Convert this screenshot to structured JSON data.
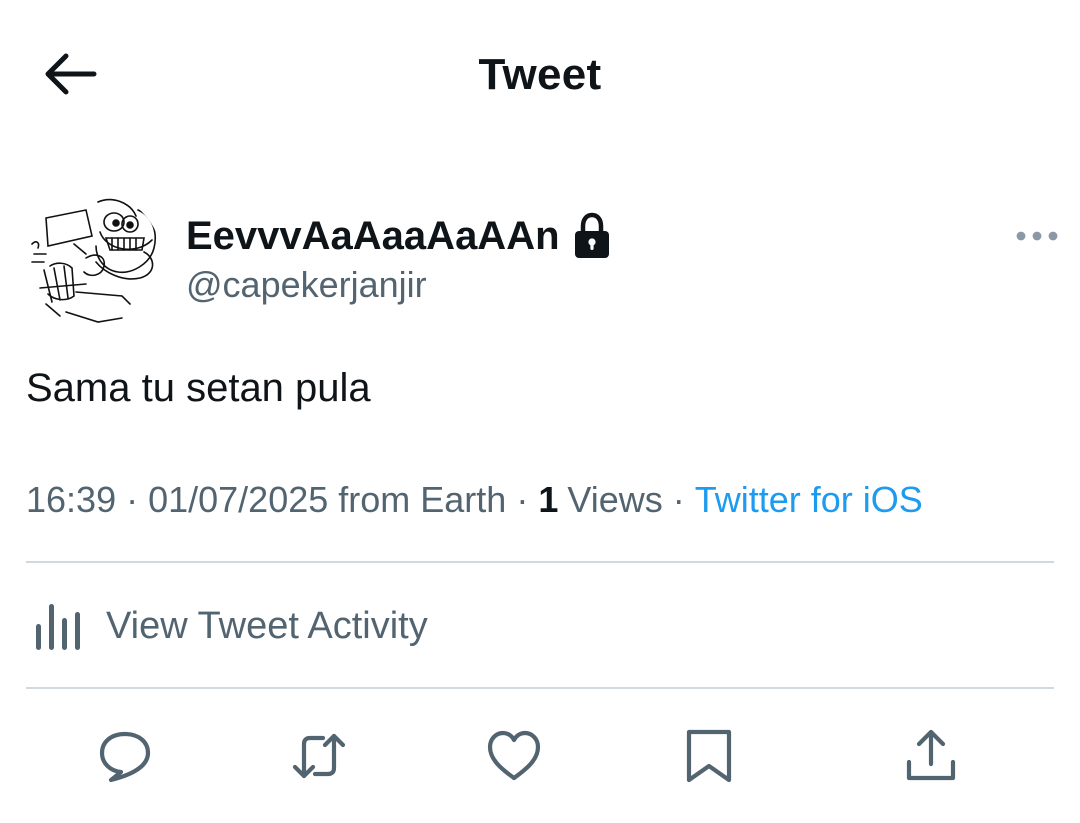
{
  "header": {
    "title": "Tweet",
    "back_icon": "back-arrow-icon"
  },
  "author": {
    "display_name": "EevvvAaAaaAaAAn",
    "handle": "@capekerjanjir",
    "protected_icon": "lock-icon",
    "avatar": "cartoon-sketch-avatar"
  },
  "tweet": {
    "text": "Sama tu setan pula"
  },
  "meta": {
    "time": "16:39",
    "separator": "·",
    "date_location": "01/07/2025 from Earth",
    "views_count": "1",
    "views_label": "Views",
    "source": "Twitter for iOS"
  },
  "activity": {
    "label": "View Tweet Activity",
    "icon": "bar-chart-icon"
  },
  "actions": [
    {
      "name": "reply",
      "icon": "reply-icon"
    },
    {
      "name": "retweet",
      "icon": "retweet-icon"
    },
    {
      "name": "like",
      "icon": "heart-icon"
    },
    {
      "name": "bookmark",
      "icon": "bookmark-icon"
    },
    {
      "name": "share",
      "icon": "share-icon"
    }
  ],
  "colors": {
    "text_primary": "#0f1419",
    "text_secondary": "#536471",
    "link": "#1d9bf0",
    "divider": "#cfd9de"
  }
}
